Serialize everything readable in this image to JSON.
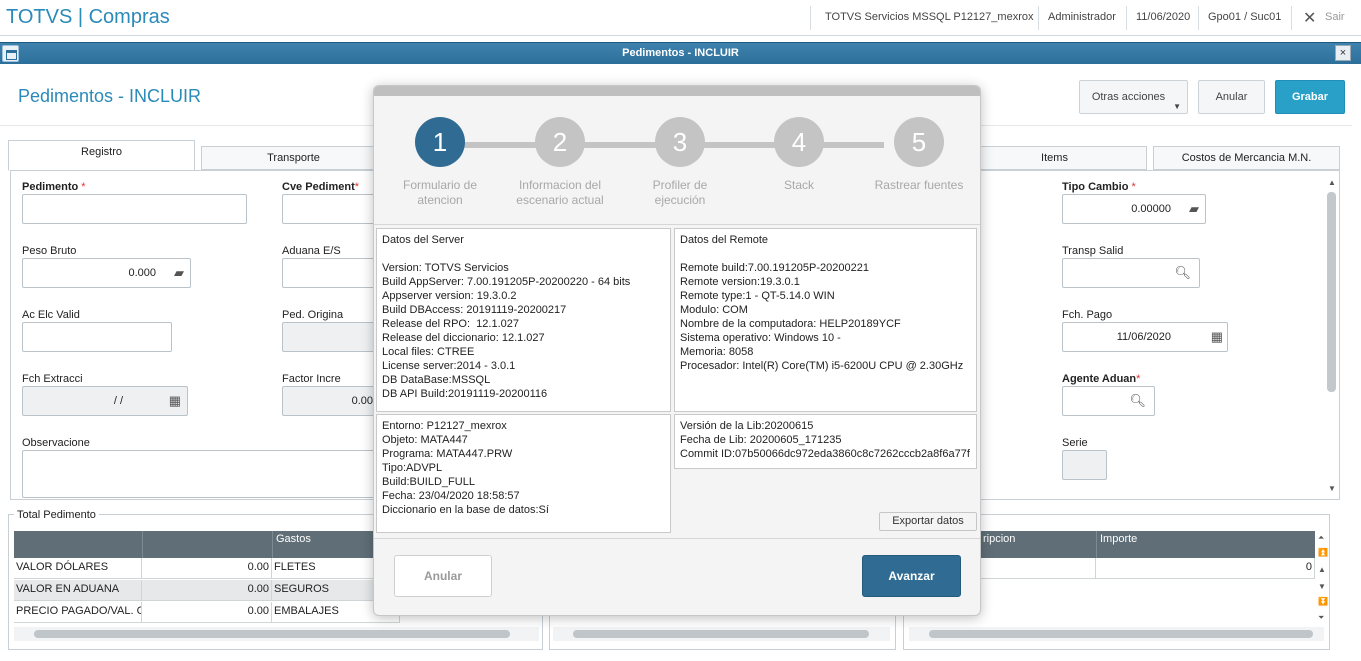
{
  "topbar": {
    "app_title": "TOTVS | Compras",
    "server": "TOTVS Servicios MSSQL P12127_mexrox",
    "user": "Administrador",
    "date": "11/06/2020",
    "branch": "Gpo01 / Suc01",
    "exit_label": "Sair"
  },
  "window": {
    "title": "Pedimentos - INCLUIR",
    "close_glyph": "×"
  },
  "header": {
    "page_title": "Pedimentos - INCLUIR",
    "other_actions_label": "Otras acciones",
    "cancel_label": "Anular",
    "save_label": "Grabar"
  },
  "tabs": {
    "registro": "Registro",
    "transporte": "Transporte",
    "items": "Items",
    "costos": "Costos de Mercancia M.N."
  },
  "form": {
    "pedimento_label": "Pedimento",
    "cve_pedimento_label": "Cve Pediment",
    "tipo_cambio_label": "Tipo Cambio",
    "tipo_cambio_value": "0.00000",
    "peso_bruto_label": "Peso Bruto",
    "peso_bruto_value": "0.000",
    "aduana_label": "Aduana E/S",
    "transp_salid_label": "Transp Salid",
    "ac_elc_valid_label": "Ac Elc Valid",
    "ped_origina_label": "Ped. Origina",
    "fch_pago_label": "Fch. Pago",
    "fch_pago_value": "11/06/2020",
    "fch_extracci_label": "Fch Extracci",
    "fch_extracci_value": "/ /",
    "factor_incre_label": "Factor Incre",
    "factor_incre_value": "0.00",
    "agente_aduan_label": "Agente Aduan",
    "observacione_label": "Observacione",
    "serie_label": "Serie",
    "required_mark": "*"
  },
  "totals": {
    "group_label": "Total Pedimento",
    "gastos_header": "Gastos",
    "rows": [
      {
        "label": "VALOR DÓLARES",
        "value": "0.00",
        "gasto": "FLETES"
      },
      {
        "label": "VALOR EN ADUANA",
        "value": "0.00",
        "gasto": "SEGUROS"
      },
      {
        "label": "PRECIO PAGADO/VAL. CO",
        "value": "0.00",
        "gasto": "EMBALAJES"
      }
    ]
  },
  "right_grid": {
    "desc_header": "ripcion",
    "importe_header": "Importe",
    "importe_value": "0"
  },
  "wizard": {
    "steps": [
      {
        "num": "1",
        "label": "Formulario de\natencion"
      },
      {
        "num": "2",
        "label": "Informacion del\nescenario actual"
      },
      {
        "num": "3",
        "label": "Profiler de\nejecución"
      },
      {
        "num": "4",
        "label": "Stack"
      },
      {
        "num": "5",
        "label": "Rastrear fuentes"
      }
    ],
    "server_box": "Datos del Server\n\nVersion: TOTVS Servicios\nBuild AppServer: 7.00.191205P-20200220 - 64 bits\nAppserver version: 19.3.0.2\nBuild DBAccess: 20191119-20200217\nRelease del RPO:  12.1.027\nRelease del diccionario: 12.1.027\nLocal files: CTREE\nLicense server:2014 - 3.0.1\nDB DataBase:MSSQL\nDB API Build:20191119-20200116",
    "remote_box": "Datos del Remote\n\nRemote build:7.00.191205P-20200221\nRemote version:19.3.0.1\nRemote type:1 - QT-5.14.0 WIN\nModulo: COM\nNombre de la computadora: HELP20189YCF\nSistema operativo: Windows 10 -\nMemoria: 8058\nProcesador: Intel(R) Core(TM) i5-6200U CPU @ 2.30GHz",
    "env_box": "Entorno: P12127_mexrox\nObjeto: MATA447\nPrograma: MATA447.PRW\nTipo:ADVPL\nBuild:BUILD_FULL\nFecha: 23/04/2020 18:58:57\nDiccionario en la base de datos:Sí",
    "lib_box": "Versión de la Lib:20200615\nFecha de Lib: 20200605_171235\nCommit ID:07b50066dc972eda3860c8c7262cccb2a8f6a77f",
    "export_label": "Exportar datos",
    "cancel_label": "Anular",
    "next_label": "Avanzar"
  }
}
